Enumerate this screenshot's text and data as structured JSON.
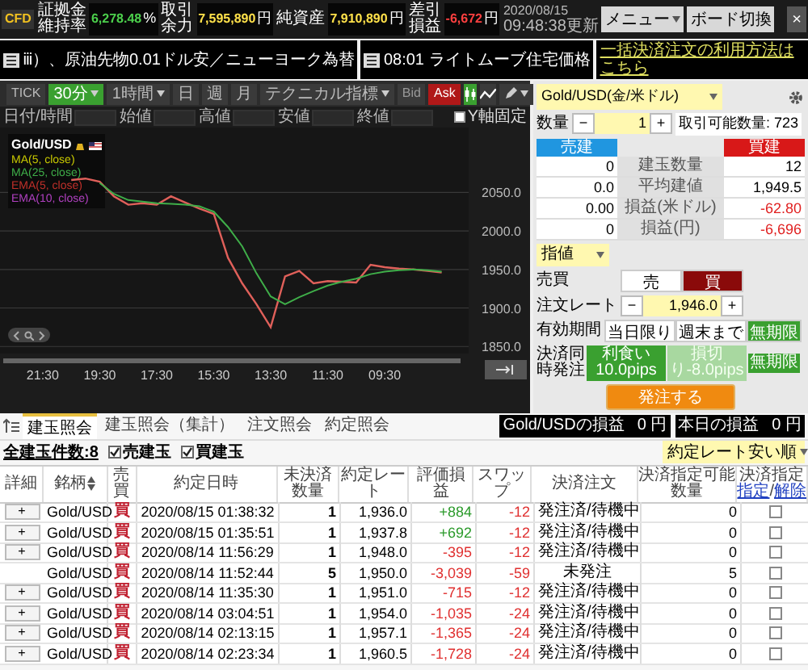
{
  "top_bar": {
    "logo": "CFD",
    "stats": [
      {
        "label": "証拠金維持率",
        "value": "6,278.48",
        "unit": "%",
        "color": "#4cd04c"
      },
      {
        "label": "取引余力",
        "value": "7,595,890",
        "unit": "円",
        "color": "#ffe14a"
      },
      {
        "label": "純資産",
        "value": "7,910,890",
        "unit": "円",
        "color": "#ffe14a"
      },
      {
        "label": "差引損益",
        "value": "-6,672",
        "unit": "円",
        "color": "#ff4040"
      }
    ],
    "updated_date": "2020/08/15",
    "updated_time": "09:48:38更新",
    "menu_button": "メニュー",
    "board_button": "ボード切換",
    "close_button": "×"
  },
  "news": [
    {
      "text": "ⅲ）、原油先物0.01ドル安／ニューヨーク為替"
    },
    {
      "text": "08:01 ライトムーブ住宅価格"
    }
  ],
  "help_link": "一括決済注文の利用方法はこちら",
  "chart_panel": {
    "periods": [
      {
        "label": "TICK",
        "selected": false,
        "dropdown": false
      },
      {
        "label": "30分",
        "selected": true,
        "dropdown": true
      },
      {
        "label": "1時間",
        "selected": false,
        "dropdown": true
      },
      {
        "label": "日",
        "selected": false,
        "dropdown": false
      },
      {
        "label": "週",
        "selected": false,
        "dropdown": false
      },
      {
        "label": "月",
        "selected": false,
        "dropdown": false
      }
    ],
    "indicator_menu": "テクニカル指標",
    "price_sides": [
      {
        "label": "Bid",
        "selected": false
      },
      {
        "label": "Ask",
        "selected": true
      }
    ],
    "chart_types": [
      {
        "kind": "candle",
        "selected": true
      },
      {
        "kind": "line",
        "selected": false
      }
    ],
    "fields": [
      "日付/時間",
      "始値",
      "高値",
      "安値",
      "終値"
    ],
    "y_fixed": {
      "label": "Y軸固定",
      "checked": false
    },
    "symbol": "Gold/USD",
    "legend": [
      {
        "label": "MA(5, close)",
        "color": "#c8c800"
      },
      {
        "label": "MA(25, close)",
        "color": "#3fae49"
      },
      {
        "label": "EMA(5, close)",
        "color": "#c0302a"
      },
      {
        "label": "EMA(10, close)",
        "color": "#b040c0"
      }
    ],
    "chart_data": {
      "type": "line",
      "grid": true,
      "categories": [
        "21:30",
        null,
        null,
        null,
        "19:30",
        null,
        null,
        null,
        "17:30",
        null,
        null,
        null,
        "15:30",
        null,
        null,
        null,
        "13:30",
        null,
        null,
        null,
        "11:30",
        null,
        null,
        null,
        "09:30",
        null,
        null,
        null,
        null
      ],
      "series": [
        {
          "color": "#e0605a",
          "values": [
            null,
            null,
            2066,
            2068,
            2064,
            2045,
            2034,
            2036,
            2034,
            2045,
            2037,
            2029,
            2022,
            1965,
            1932,
            1905,
            1875,
            1941,
            1948,
            1932,
            1935,
            1934,
            1933,
            1956,
            1953,
            1951,
            1950,
            1948,
            1946
          ]
        },
        {
          "color": "#3fae49",
          "values": [
            null,
            null,
            null,
            null,
            2062,
            2048,
            2040,
            2038,
            2036,
            2035,
            2034,
            2032,
            2025,
            2005,
            1980,
            1945,
            1915,
            1905,
            1914,
            1922,
            1929,
            1934,
            1938,
            1944,
            1947,
            1949,
            1950,
            1949,
            1947
          ]
        }
      ],
      "ylim": [
        1845,
        2130
      ],
      "yticks": [
        {
          "value": 1850,
          "label": "1850.0"
        },
        {
          "value": 1900,
          "label": "1900.0"
        },
        {
          "value": 1950,
          "label": "1950.0"
        },
        {
          "value": 2000,
          "label": "2000.0"
        },
        {
          "value": 2050,
          "label": "2050.0"
        }
      ]
    }
  },
  "order_panel": {
    "symbol": "Gold/USD(金/米ドル)",
    "quantity": {
      "label": "数量",
      "value": "1",
      "minus": "−",
      "plus": "+",
      "available": "取引可能数量: 723"
    },
    "positions": {
      "sell_header": "売建",
      "buy_header": "買建",
      "rows": [
        {
          "label": "建玉数量",
          "sell": "0",
          "buy": "12",
          "negative": false
        },
        {
          "label": "平均建値",
          "sell": "0.0",
          "buy": "1,949.5",
          "negative": false
        },
        {
          "label": "損益(米ドル)",
          "sell": "0.00",
          "buy": "-62.80",
          "negative": true
        },
        {
          "label": "損益(円)",
          "sell": "0",
          "buy": "-6,696",
          "negative": true
        }
      ]
    },
    "order_type": "指値",
    "side": {
      "label": "売買",
      "options": [
        {
          "label": "売",
          "selected": false
        },
        {
          "label": "買",
          "selected": true
        }
      ]
    },
    "rate": {
      "label": "注文レート",
      "value": "1,946.0",
      "minus": "−",
      "plus": "+"
    },
    "expiry": {
      "label": "有効期間",
      "options": [
        {
          "label": "当日限り",
          "selected": false
        },
        {
          "label": "週末まで",
          "selected": false
        },
        {
          "label": "無期限",
          "selected": true
        }
      ]
    },
    "settle": {
      "label": "決済同時発注",
      "options": [
        {
          "label": "利食い10.0pips",
          "on": true
        },
        {
          "label": "損切り-8.0pips",
          "on": false
        },
        {
          "label": "無期限",
          "on": true
        }
      ]
    },
    "submit": "発注する"
  },
  "positions_panel": {
    "tabs": [
      {
        "label": "建玉照会",
        "selected": true
      },
      {
        "label": "建玉照会（集計）",
        "selected": false
      },
      {
        "label": "注文照会",
        "selected": false
      },
      {
        "label": "約定照会",
        "selected": false
      }
    ],
    "pnl": [
      {
        "label": "Gold/USDの損益",
        "value": "0 円"
      },
      {
        "label": "本日の損益",
        "value": "0 円"
      }
    ],
    "total_count": "全建玉件数:8",
    "filters": [
      {
        "label": "売建玉",
        "checked": true
      },
      {
        "label": "買建玉",
        "checked": true
      }
    ],
    "sort": "約定レート安い順",
    "columns": [
      "詳細",
      "銘柄",
      "売買",
      "約定日時",
      "未決済数量",
      "約定レート",
      "評価損益",
      "スワップ",
      "決済注文",
      "決済指定可能数量",
      "決済指定"
    ],
    "designate_links": [
      "指定",
      "解除"
    ],
    "link_separator": "/",
    "rows": [
      {
        "detail": "+",
        "symbol": "Gold/USD",
        "side": "買",
        "time": "2020/08/15 01:38:32",
        "qty": "1",
        "rate": "1,936.0",
        "pnl": "+884",
        "positive": true,
        "swap": "-12",
        "order": "発注済/待機中",
        "available": "0",
        "checked": false
      },
      {
        "detail": "+",
        "symbol": "Gold/USD",
        "side": "買",
        "time": "2020/08/15 01:35:51",
        "qty": "1",
        "rate": "1,937.8",
        "pnl": "+692",
        "positive": true,
        "swap": "-12",
        "order": "発注済/待機中",
        "available": "0",
        "checked": false
      },
      {
        "detail": "+",
        "symbol": "Gold/USD",
        "side": "買",
        "time": "2020/08/14 11:56:29",
        "qty": "1",
        "rate": "1,948.0",
        "pnl": "-395",
        "positive": false,
        "swap": "-12",
        "order": "発注済/待機中",
        "available": "0",
        "checked": false
      },
      {
        "symbol": "Gold/USD",
        "side": "買",
        "time": "2020/08/14 11:52:44",
        "qty": "5",
        "rate": "1,950.0",
        "pnl": "-3,039",
        "positive": false,
        "swap": "-59",
        "order": "未発注",
        "available": "5",
        "checked": false
      },
      {
        "detail": "+",
        "symbol": "Gold/USD",
        "side": "買",
        "time": "2020/08/14 11:35:30",
        "qty": "1",
        "rate": "1,951.0",
        "pnl": "-715",
        "positive": false,
        "swap": "-12",
        "order": "発注済/待機中",
        "available": "0",
        "checked": false
      },
      {
        "detail": "+",
        "symbol": "Gold/USD",
        "side": "買",
        "time": "2020/08/14 03:04:51",
        "qty": "1",
        "rate": "1,954.0",
        "pnl": "-1,035",
        "positive": false,
        "swap": "-24",
        "order": "発注済/待機中",
        "available": "0",
        "checked": false
      },
      {
        "detail": "+",
        "symbol": "Gold/USD",
        "side": "買",
        "time": "2020/08/14 02:13:15",
        "qty": "1",
        "rate": "1,957.1",
        "pnl": "-1,365",
        "positive": false,
        "swap": "-24",
        "order": "発注済/待機中",
        "available": "0",
        "checked": false
      },
      {
        "detail": "+",
        "symbol": "Gold/USD",
        "side": "買",
        "time": "2020/08/14 02:23:34",
        "qty": "1",
        "rate": "1,960.5",
        "pnl": "-1,728",
        "positive": false,
        "swap": "-24",
        "order": "発注済/待機中",
        "available": "0",
        "checked": false
      }
    ]
  }
}
